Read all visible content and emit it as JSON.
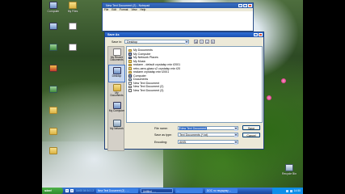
{
  "desktop": {
    "icons": [
      {
        "label": "Computer"
      },
      {
        "label": "My Files"
      },
      {
        "label": ""
      },
      {
        "label": ""
      },
      {
        "label": ""
      },
      {
        "label": ""
      },
      {
        "label": ""
      },
      {
        "label": ""
      },
      {
        "label": ""
      },
      {
        "label": ""
      },
      {
        "label": ""
      }
    ],
    "recycle_bin_label": "Recycle Bin"
  },
  "notepad": {
    "title": "New Text Document (2) - Notepad",
    "menu": [
      "File",
      "Edit",
      "Format",
      "View",
      "Help"
    ]
  },
  "dialog": {
    "title": "Save As",
    "save_in_label": "Save in:",
    "save_in_value": "Desktop",
    "toolbar_icons": [
      "back-icon",
      "up-folder-icon",
      "new-folder-icon",
      "views-menu-icon"
    ],
    "places": [
      {
        "label": "My Recent Documents",
        "icon": "recent-documents-icon"
      },
      {
        "label": "Desktop",
        "icon": "desktop-icon"
      },
      {
        "label": "My Documents",
        "icon": "my-documents-icon"
      },
      {
        "label": "My Computer",
        "icon": "my-computer-icon"
      },
      {
        "label": "My Network",
        "icon": "my-network-icon"
      }
    ],
    "files": [
      {
        "name": "My Documents",
        "icon": "folder"
      },
      {
        "name": "My Computer",
        "icon": "pc"
      },
      {
        "name": "My Network Places",
        "icon": "net"
      },
      {
        "name": "My Music",
        "icon": "folder"
      },
      {
        "name": "realarm - default crystalsp min t2001",
        "icon": "folder"
      },
      {
        "name": "retro-aero-glass v2 crystalsp min t20",
        "icon": "folder"
      },
      {
        "name": "realarm crystalsp min t2001",
        "icon": "folder"
      },
      {
        "name": "Computer",
        "icon": "pc"
      },
      {
        "name": "Documents",
        "icon": "doc"
      },
      {
        "name": "New Text Document",
        "icon": "txt"
      },
      {
        "name": "New Text Document (2)",
        "icon": "txt"
      },
      {
        "name": "New Text Document (3)",
        "icon": "txt"
      }
    ],
    "file_name_label": "File name:",
    "file_name_value": "New Text Document",
    "save_as_type_label": "Save as type:",
    "save_as_type_value": "Text Documents (*.txt)",
    "encoding_label": "Encoding:",
    "encoding_value": "ANSI",
    "save_button": "Save",
    "cancel_button": "Cancel"
  },
  "taskbar": {
    "start_label": "start",
    "ticker": "14:00 04 04 1 2013",
    "tasks": [
      "New Text Document (2) - ...",
      "Untitled - ...",
      "...",
      "DOC по текущему ..."
    ],
    "clock": "14:50"
  }
}
